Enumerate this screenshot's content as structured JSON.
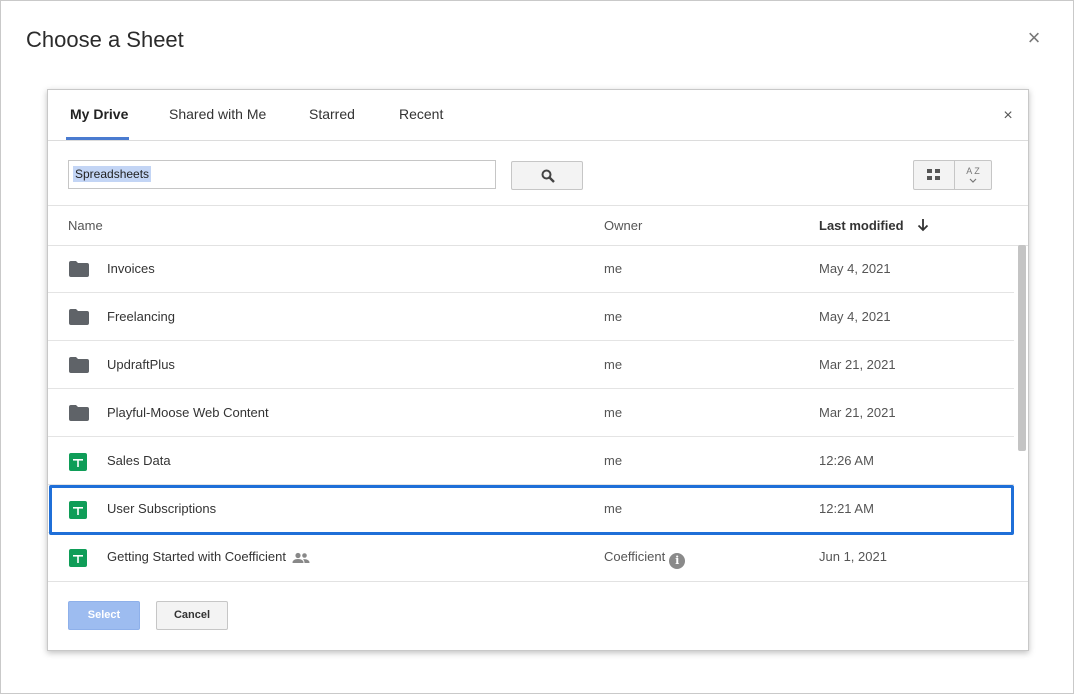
{
  "dialog": {
    "title": "Choose a Sheet",
    "close_symbol": "×"
  },
  "picker": {
    "close_symbol": "×",
    "tabs": [
      {
        "label": "My Drive",
        "active": true
      },
      {
        "label": "Shared with Me",
        "active": false
      },
      {
        "label": "Starred",
        "active": false
      },
      {
        "label": "Recent",
        "active": false
      }
    ],
    "search": {
      "value": "Spreadsheets"
    },
    "sort_icon_label": "A Z",
    "columns": {
      "name": "Name",
      "owner": "Owner",
      "modified": "Last modified"
    },
    "rows": [
      {
        "type": "folder",
        "name": "Invoices",
        "owner": "me",
        "modified": "May 4, 2021"
      },
      {
        "type": "folder",
        "name": "Freelancing",
        "owner": "me",
        "modified": "May 4, 2021"
      },
      {
        "type": "folder",
        "name": "UpdraftPlus",
        "owner": "me",
        "modified": "Mar 21, 2021"
      },
      {
        "type": "folder",
        "name": "Playful-Moose Web Content",
        "owner": "me",
        "modified": "Mar 21, 2021"
      },
      {
        "type": "sheet",
        "name": "Sales Data",
        "owner": "me",
        "modified": "12:26 AM"
      },
      {
        "type": "sheet",
        "name": "User Subscriptions",
        "owner": "me",
        "modified": "12:21 AM",
        "highlighted": true
      },
      {
        "type": "sheet",
        "name": "Getting Started with Coefficient",
        "owner": "Coefficient",
        "modified": "Jun 1, 2021",
        "shared": true
      }
    ],
    "buttons": {
      "select": "Select",
      "cancel": "Cancel"
    }
  },
  "colors": {
    "accent": "#4a7bd0",
    "highlight": "#1f6fd8",
    "sheet_green": "#0f9d58",
    "folder_gray": "#5f6368",
    "select_disabled": "#9dbcf0"
  }
}
